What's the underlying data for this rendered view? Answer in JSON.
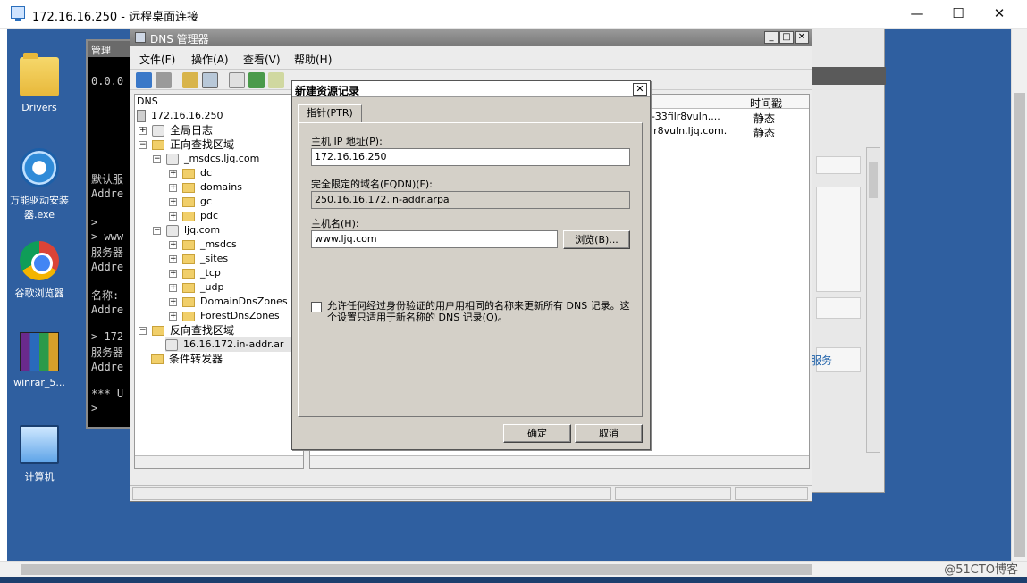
{
  "rdp": {
    "title": "172.16.16.250 - 远程桌面连接",
    "minimize": "—",
    "maximize": "☐",
    "close": "✕",
    "watermark": "@51CTO博客"
  },
  "desktop_icons": [
    {
      "label": "Drivers",
      "icon": "folder-icon"
    },
    {
      "label": "万能驱动安装器.exe",
      "icon": "gear-icon"
    },
    {
      "label": "谷歌浏览器",
      "icon": "chrome-icon"
    },
    {
      "label": "winrar_5...",
      "icon": "winrar-icon"
    },
    {
      "label": "计算机",
      "icon": "computer-icon"
    }
  ],
  "cmd": {
    "title": "管理",
    "lines": [
      "0.0.0",
      "默认服",
      "Addre",
      ">",
      "> www",
      "服务器",
      "Addre",
      "名称:",
      "Addre",
      "> 172",
      "服务器",
      "Addre",
      "*** U",
      ">"
    ]
  },
  "bg_window": {
    "service_text": "服务"
  },
  "dns": {
    "title": "DNS 管理器",
    "menu": [
      "文件(F)",
      "操作(A)",
      "查看(V)",
      "帮助(H)"
    ],
    "tree": {
      "root": "DNS",
      "server": "172.16.16.250",
      "global_logs": "全局日志",
      "forward_zones": "正向查找区域",
      "msdcs_zone": "_msdcs.ljq.com",
      "msdcs_children": [
        "dc",
        "domains",
        "gc",
        "pdc"
      ],
      "ljq_zone": "ljq.com",
      "ljq_children": [
        "_msdcs",
        "_sites",
        "_tcp",
        "_udp",
        "DomainDnsZones",
        "ForestDnsZones"
      ],
      "reverse_zones": "反向查找区域",
      "reverse_zone": "16.16.172.in-addr.ar",
      "forwarders": "条件转发器"
    },
    "list": {
      "col_timestamp": "时间戳",
      "rows": [
        {
          "name": "r-33filr8vuln....",
          "ts": "静态"
        },
        {
          "name": "ilr8vuln.ljq.com.",
          "ts": "静态"
        }
      ]
    }
  },
  "dialog": {
    "title": "新建资源记录",
    "close": "✕",
    "tab": "指针(PTR)",
    "host_ip_label": "主机 IP 地址(P):",
    "host_ip_value": "172.16.16.250",
    "fqdn_label": "完全限定的域名(FQDN)(F):",
    "fqdn_value": "250.16.16.172.in-addr.arpa",
    "hostname_label": "主机名(H):",
    "hostname_value": "www.ljq.com",
    "browse": "浏览(B)...",
    "checkbox_label": "允许任何经过身份验证的用户用相同的名称来更新所有 DNS 记录。这个设置只适用于新名称的 DNS 记录(O)。",
    "checkbox_checked": false,
    "ok": "确定",
    "cancel": "取消"
  }
}
